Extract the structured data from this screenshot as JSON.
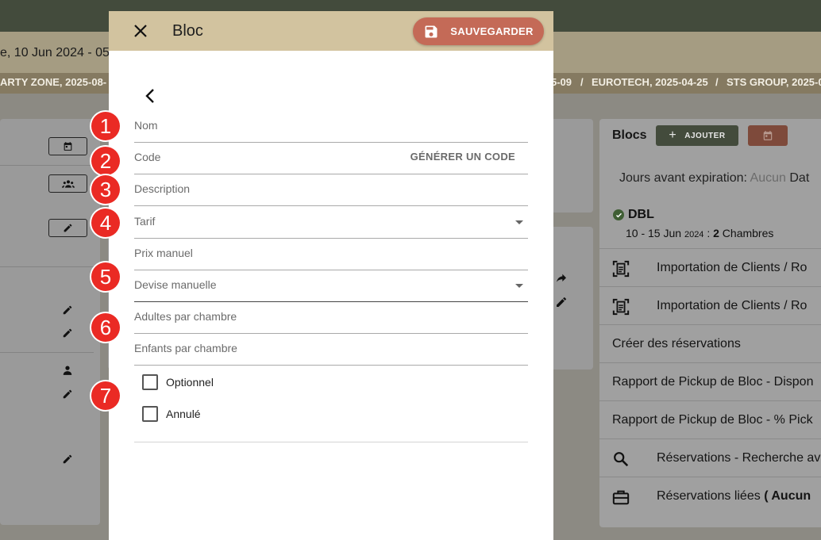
{
  "background": {
    "date_text": "e, 10 Jun 2024 - 05",
    "breadcrumbs": [
      "ARTY ZONE, 2025-08-",
      "5-09",
      "/",
      "EUROTECH, 2025-04-25",
      "/",
      "STS GROUP, 2025-0"
    ]
  },
  "right_panel": {
    "title": "Blocs",
    "add_label": "AJOUTER",
    "expiry_label": "Jours avant expiration:",
    "expiry_value": "Aucun",
    "expiry_tail": "Dat",
    "block_code": "DBL",
    "block_dates": "10 - 15 Jun",
    "block_year": "2024",
    "block_sep": ":",
    "block_rooms_count": "2",
    "block_rooms_label": "Chambres",
    "items": [
      {
        "label": "Importation de Clients / Ro",
        "icon": "document-scan-icon"
      },
      {
        "label": "Importation de Clients / Ro",
        "icon": "document-scan-icon"
      },
      {
        "label": "Créer des réservations",
        "icon": ""
      },
      {
        "label": "Rapport de Pickup de Bloc - Dispon",
        "icon": ""
      },
      {
        "label": "Rapport de Pickup de Bloc - % Pick",
        "icon": ""
      },
      {
        "label": "Réservations - Recherche av",
        "icon": "search-icon"
      },
      {
        "label": "Réservations liées",
        "label_bold": "( Aucun",
        "icon": "briefcase-icon"
      }
    ]
  },
  "dialog": {
    "title": "Bloc",
    "save_label": "SAUVEGARDER",
    "fields": {
      "nom": "Nom",
      "code": "Code",
      "generate_code": "GÉNÉRER UN CODE",
      "description": "Description",
      "tarif": "Tarif",
      "prix_manuel": "Prix manuel",
      "devise_manuelle": "Devise manuelle",
      "adultes": "Adultes par chambre",
      "enfants": "Enfants par chambre"
    },
    "checkboxes": {
      "optionnel": "Optionnel",
      "annule": "Annulé"
    }
  },
  "badges": [
    "1",
    "2",
    "3",
    "4",
    "5",
    "6",
    "7"
  ],
  "colors": {
    "dialog_header": "#d2c39f",
    "save_button": "#c46a57",
    "badge": "#ea2a24",
    "topbar": "#434b3c"
  }
}
